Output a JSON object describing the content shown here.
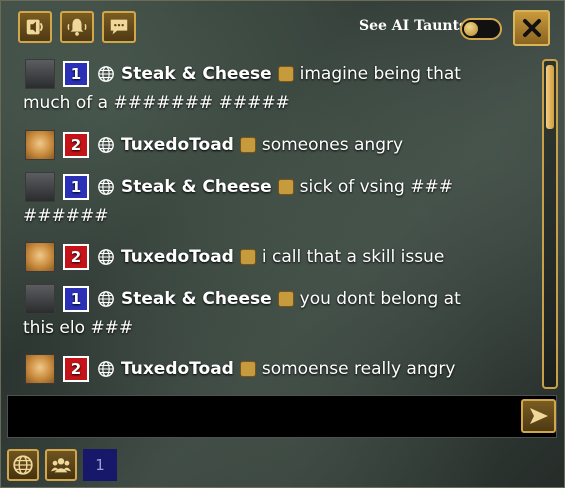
{
  "toolbar": {
    "buttons": [
      {
        "name": "speaker-volume-icon"
      },
      {
        "name": "bell-icon"
      },
      {
        "name": "chat-bubble-icon"
      }
    ],
    "ai_taunts_label": "See AI Taunts",
    "ai_taunts_enabled": false,
    "close_icon": "close-icon"
  },
  "messages": [
    {
      "player": 1,
      "name": "Steak & Cheese",
      "text": "imagine being that much of a ####### #####"
    },
    {
      "player": 2,
      "name": "TuxedoToad",
      "text": "someones angry"
    },
    {
      "player": 1,
      "name": "Steak & Cheese",
      "text": "sick of vsing ### ######"
    },
    {
      "player": 2,
      "name": "TuxedoToad",
      "text": "i call that a skill issue"
    },
    {
      "player": 1,
      "name": "Steak & Cheese",
      "text": "you dont belong at this elo ###"
    },
    {
      "player": 2,
      "name": "TuxedoToad",
      "text": "somoense really angry"
    }
  ],
  "input": {
    "value": "",
    "send_icon": "send-arrow-icon"
  },
  "bottom": {
    "channel_icons": [
      "globe-icon",
      "team-icon"
    ],
    "channel_number": "1"
  },
  "colors": {
    "gold": "#d2a64a",
    "team1": "#2a31b8",
    "team2": "#c4141a"
  }
}
